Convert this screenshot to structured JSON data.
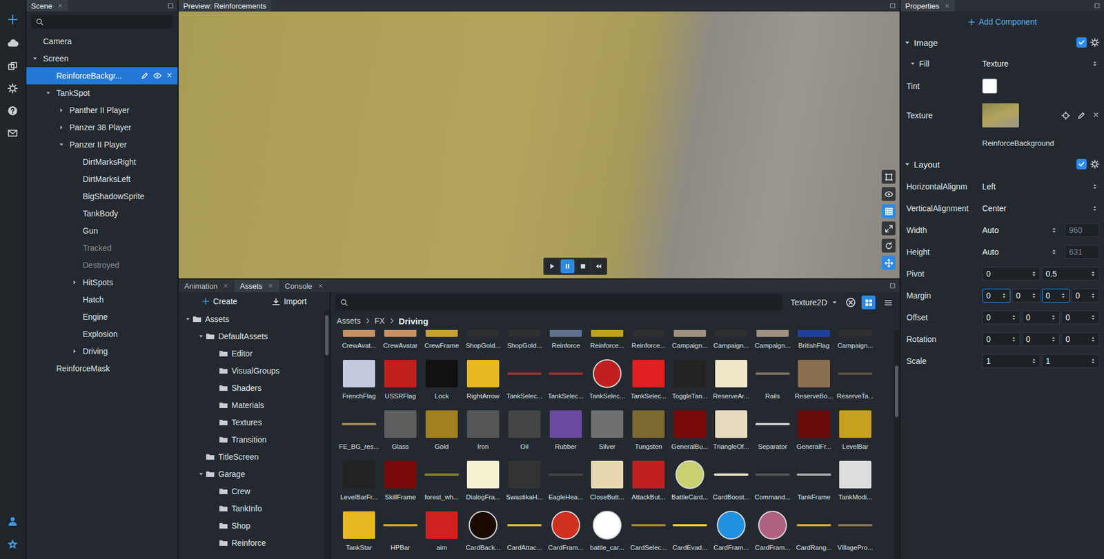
{
  "scene": {
    "tab": "Scene",
    "tree": [
      {
        "label": "Camera",
        "depth": 0,
        "has_children": false,
        "expanded": false,
        "selected": false,
        "disabled": false
      },
      {
        "label": "Screen",
        "depth": 0,
        "has_children": true,
        "expanded": true,
        "selected": false,
        "disabled": false
      },
      {
        "label": "ReinforceBackgr...",
        "depth": 1,
        "has_children": false,
        "expanded": false,
        "selected": true,
        "disabled": false
      },
      {
        "label": "TankSpot",
        "depth": 1,
        "has_children": true,
        "expanded": true,
        "selected": false,
        "disabled": false
      },
      {
        "label": "Panther II Player",
        "depth": 2,
        "has_children": true,
        "expanded": false,
        "selected": false,
        "disabled": false
      },
      {
        "label": "Panzer 38 Player",
        "depth": 2,
        "has_children": true,
        "expanded": false,
        "selected": false,
        "disabled": false
      },
      {
        "label": "Panzer II Player",
        "depth": 2,
        "has_children": true,
        "expanded": true,
        "selected": false,
        "disabled": false
      },
      {
        "label": "DirtMarksRight",
        "depth": 3,
        "has_children": false,
        "expanded": false,
        "selected": false,
        "disabled": false
      },
      {
        "label": "DirtMarksLeft",
        "depth": 3,
        "has_children": false,
        "expanded": false,
        "selected": false,
        "disabled": false
      },
      {
        "label": "BigShadowSprite",
        "depth": 3,
        "has_children": false,
        "expanded": false,
        "selected": false,
        "disabled": false
      },
      {
        "label": "TankBody",
        "depth": 3,
        "has_children": false,
        "expanded": false,
        "selected": false,
        "disabled": false
      },
      {
        "label": "Gun",
        "depth": 3,
        "has_children": false,
        "expanded": false,
        "selected": false,
        "disabled": false
      },
      {
        "label": "Tracked",
        "depth": 3,
        "has_children": false,
        "expanded": false,
        "selected": false,
        "disabled": true
      },
      {
        "label": "Destroyed",
        "depth": 3,
        "has_children": false,
        "expanded": false,
        "selected": false,
        "disabled": true
      },
      {
        "label": "HitSpots",
        "depth": 3,
        "has_children": true,
        "expanded": false,
        "selected": false,
        "disabled": false
      },
      {
        "label": "Hatch",
        "depth": 3,
        "has_children": false,
        "expanded": false,
        "selected": false,
        "disabled": false
      },
      {
        "label": "Engine",
        "depth": 3,
        "has_children": false,
        "expanded": false,
        "selected": false,
        "disabled": false
      },
      {
        "label": "Explosion",
        "depth": 3,
        "has_children": false,
        "expanded": false,
        "selected": false,
        "disabled": false
      },
      {
        "label": "Driving",
        "depth": 3,
        "has_children": true,
        "expanded": false,
        "selected": false,
        "disabled": false
      },
      {
        "label": "ReinforceMask",
        "depth": 1,
        "has_children": false,
        "expanded": false,
        "selected": false,
        "disabled": false
      }
    ]
  },
  "preview": {
    "tab": "Preview: Reinforcements",
    "tools": [
      {
        "kind": "select",
        "selected": false
      },
      {
        "kind": "visibility",
        "selected": false
      },
      {
        "kind": "grid",
        "selected": true
      },
      {
        "kind": "expand",
        "selected": false
      },
      {
        "kind": "refresh",
        "selected": false
      },
      {
        "kind": "move",
        "selected": true
      }
    ],
    "playback": [
      {
        "kind": "play",
        "selected": false
      },
      {
        "kind": "pause",
        "selected": true
      },
      {
        "kind": "stop",
        "selected": false
      },
      {
        "kind": "rewind",
        "selected": false
      }
    ]
  },
  "properties": {
    "tab": "Properties",
    "add_component": "Add Component",
    "image": {
      "title": "Image",
      "expanded": true,
      "enabled": true,
      "fill": {
        "label": "Fill",
        "value": "Texture",
        "expanded": true
      },
      "tint": {
        "label": "Tint",
        "color": "#ffffff"
      },
      "texture": {
        "label": "Texture",
        "name": "ReinforceBackground"
      }
    },
    "layout": {
      "title": "Layout",
      "expanded": true,
      "enabled": true,
      "rows": [
        {
          "kind": "dropdown",
          "label": "HorizontalAlignm",
          "value": "Left"
        },
        {
          "kind": "dropdown",
          "label": "VerticalAlignment",
          "value": "Center"
        },
        {
          "kind": "size",
          "label": "Width",
          "value": "Auto",
          "computed": "960",
          "disabled": true
        },
        {
          "kind": "size",
          "label": "Height",
          "value": "Auto",
          "computed": "631",
          "disabled": true
        },
        {
          "kind": "numbers",
          "label": "Pivot",
          "fields": [
            {
              "value": "0",
              "focused": false
            },
            {
              "value": "0.5",
              "focused": false
            }
          ]
        },
        {
          "kind": "numbers",
          "label": "Margin",
          "fields": [
            {
              "value": "0",
              "focused": true
            },
            {
              "value": "0",
              "focused": false
            },
            {
              "value": "0",
              "focused": true
            },
            {
              "value": "0",
              "focused": false
            }
          ]
        },
        {
          "kind": "numbers",
          "label": "Offset",
          "fields": [
            {
              "value": "0",
              "focused": false
            },
            {
              "value": "0",
              "focused": false
            },
            {
              "value": "0",
              "focused": false
            }
          ]
        },
        {
          "kind": "numbers",
          "label": "Rotation",
          "fields": [
            {
              "value": "0",
              "focused": false
            },
            {
              "value": "0",
              "focused": false
            },
            {
              "value": "0",
              "focused": false
            }
          ]
        },
        {
          "kind": "numbers",
          "label": "Scale",
          "fields": [
            {
              "value": "1",
              "focused": false
            },
            {
              "value": "1",
              "focused": false
            }
          ]
        }
      ]
    }
  },
  "bottom": {
    "tabs": [
      {
        "label": "Animation",
        "selected": false
      },
      {
        "label": "Assets",
        "selected": true
      },
      {
        "label": "Console",
        "selected": false
      }
    ],
    "assets": {
      "create": "Create",
      "import": "Import",
      "tree": [
        {
          "label": "Assets",
          "depth": 0,
          "has_children": true,
          "expanded": true
        },
        {
          "label": "DefaultAssets",
          "depth": 1,
          "has_children": true,
          "expanded": true
        },
        {
          "label": "Editor",
          "depth": 2,
          "has_children": false,
          "expanded": false
        },
        {
          "label": "VisualGroups",
          "depth": 2,
          "has_children": false,
          "expanded": false
        },
        {
          "label": "Shaders",
          "depth": 2,
          "has_children": false,
          "expanded": false
        },
        {
          "label": "Materials",
          "depth": 2,
          "has_children": false,
          "expanded": false
        },
        {
          "label": "Textures",
          "depth": 2,
          "has_children": false,
          "expanded": false
        },
        {
          "label": "Transition",
          "depth": 2,
          "has_children": false,
          "expanded": false
        },
        {
          "label": "TitleScreen",
          "depth": 1,
          "has_children": false,
          "expanded": false
        },
        {
          "label": "Garage",
          "depth": 1,
          "has_children": true,
          "expanded": true
        },
        {
          "label": "Crew",
          "depth": 2,
          "has_children": false,
          "expanded": false
        },
        {
          "label": "TankInfo",
          "depth": 2,
          "has_children": false,
          "expanded": false
        },
        {
          "label": "Shop",
          "depth": 2,
          "has_children": false,
          "expanded": false
        },
        {
          "label": "Reinforce",
          "depth": 2,
          "has_children": false,
          "expanded": false
        }
      ],
      "filter": "Texture2D",
      "views": [
        {
          "kind": "grid",
          "selected": true
        },
        {
          "kind": "list",
          "selected": false
        }
      ],
      "breadcrumb": [
        "Assets",
        "FX",
        "Driving"
      ],
      "items": [
        {
          "name": "CrewAvat...",
          "kind": "rect",
          "color": "#c89060"
        },
        {
          "name": "CrewAvatar",
          "kind": "rect",
          "color": "#c89060"
        },
        {
          "name": "CrewFrame",
          "kind": "rect",
          "color": "#c8a030"
        },
        {
          "name": "ShopGold...",
          "kind": "rect",
          "color": "#303030"
        },
        {
          "name": "ShopGold...",
          "kind": "rect",
          "color": "#303030"
        },
        {
          "name": "Reinforce",
          "kind": "rect",
          "color": "#607090"
        },
        {
          "name": "Reinforce...",
          "kind": "rect",
          "color": "#c0a020"
        },
        {
          "name": "Reinforce...",
          "kind": "rect",
          "color": "#303030"
        },
        {
          "name": "Campaign...",
          "kind": "rect",
          "color": "#a09080"
        },
        {
          "name": "Campaign...",
          "kind": "rect",
          "color": "#303030"
        },
        {
          "name": "Campaign...",
          "kind": "rect",
          "color": "#a09080"
        },
        {
          "name": "BritishFlag",
          "kind": "rect",
          "color": "#2040a0"
        },
        {
          "name": "Campaign...",
          "kind": "rect",
          "color": "#303030"
        },
        {
          "name": "FrenchFlag",
          "kind": "rect",
          "color": "#c4cbe0"
        },
        {
          "name": "USSRFlag",
          "kind": "rect",
          "color": "#c0201c"
        },
        {
          "name": "Lock",
          "kind": "rect",
          "color": "#111111"
        },
        {
          "name": "RightArrow",
          "kind": "rect",
          "color": "#e8b820"
        },
        {
          "name": "TankSelec...",
          "kind": "line",
          "color": "#a03030"
        },
        {
          "name": "TankSelec...",
          "kind": "line",
          "color": "#a03030"
        },
        {
          "name": "TankSelec...",
          "kind": "circle",
          "color": "#c02020"
        },
        {
          "name": "TankSelec...",
          "kind": "rect",
          "color": "#e02020"
        },
        {
          "name": "ToggleTan...",
          "kind": "rect",
          "color": "#222222"
        },
        {
          "name": "ReserveAr...",
          "kind": "rect",
          "color": "#f0e8c8"
        },
        {
          "name": "Rails",
          "kind": "line",
          "color": "#807060"
        },
        {
          "name": "ReserveBo...",
          "kind": "rect",
          "color": "#8a7050"
        },
        {
          "name": "ReserveTa...",
          "kind": "line",
          "color": "#605040"
        },
        {
          "name": "FE_BG_res...",
          "kind": "line",
          "color": "#a08860"
        },
        {
          "name": "Glass",
          "kind": "rect",
          "color": "#5e5e5e"
        },
        {
          "name": "Gold",
          "kind": "rect",
          "color": "#a08020"
        },
        {
          "name": "Iron",
          "kind": "rect",
          "color": "#555555"
        },
        {
          "name": "Oil",
          "kind": "rect",
          "color": "#444444"
        },
        {
          "name": "Rubber",
          "kind": "rect",
          "color": "#6a4aa0"
        },
        {
          "name": "Silver",
          "kind": "rect",
          "color": "#707070"
        },
        {
          "name": "Tungsten",
          "kind": "rect",
          "color": "#7a6a30"
        },
        {
          "name": "GeneralBu...",
          "kind": "rect",
          "color": "#7a0a0a"
        },
        {
          "name": "TriangleOf...",
          "kind": "rect",
          "color": "#e8dcc0"
        },
        {
          "name": "Separator",
          "kind": "line",
          "color": "#cccccc"
        },
        {
          "name": "GeneralFr...",
          "kind": "rect",
          "color": "#6a0a0a"
        },
        {
          "name": "LevelBar",
          "kind": "rect",
          "color": "#c8a020"
        },
        {
          "name": "LevelBarFr...",
          "kind": "rect",
          "color": "#222222"
        },
        {
          "name": "SkillFrame",
          "kind": "rect",
          "color": "#7a0a0a"
        },
        {
          "name": "forest_wh...",
          "kind": "line",
          "color": "#8a8030"
        },
        {
          "name": "DialogFra...",
          "kind": "rect",
          "color": "#f5f0d0"
        },
        {
          "name": "SwastikaH...",
          "kind": "rect",
          "color": "#333333"
        },
        {
          "name": "EagleHea...",
          "kind": "line",
          "color": "#444444"
        },
        {
          "name": "CloseButt...",
          "kind": "rect",
          "color": "#e8d8b0"
        },
        {
          "name": "AttackBut...",
          "kind": "rect",
          "color": "#c02020"
        },
        {
          "name": "BattleCard...",
          "kind": "circle",
          "color": "#c8d070"
        },
        {
          "name": "CardBoost...",
          "kind": "line",
          "color": "#f0e8c8"
        },
        {
          "name": "Command...",
          "kind": "line",
          "color": "#555555"
        },
        {
          "name": "TankFrame",
          "kind": "line",
          "color": "#aaaaaa"
        },
        {
          "name": "TankModi...",
          "kind": "rect",
          "color": "#dddddd"
        },
        {
          "name": "TankStar",
          "kind": "rect",
          "color": "#e8b820"
        },
        {
          "name": "HPBar",
          "kind": "line",
          "color": "#c8a020"
        },
        {
          "name": "aim",
          "kind": "rect",
          "color": "#d02020"
        },
        {
          "name": "CardBack...",
          "kind": "circle",
          "color": "#1a0a00"
        },
        {
          "name": "CardAttac...",
          "kind": "line",
          "color": "#d0b040"
        },
        {
          "name": "CardFram...",
          "kind": "circle",
          "color": "#d03020"
        },
        {
          "name": "battle_car...",
          "kind": "circle",
          "color": "#ffffff"
        },
        {
          "name": "CardSelec...",
          "kind": "line",
          "color": "#a08030"
        },
        {
          "name": "CardEvad...",
          "kind": "line",
          "color": "#e8c030"
        },
        {
          "name": "CardFram...",
          "kind": "circle",
          "color": "#2090e0"
        },
        {
          "name": "CardFram...",
          "kind": "circle",
          "color": "#b06080"
        },
        {
          "name": "CardRang...",
          "kind": "line",
          "color": "#d0a030"
        },
        {
          "name": "VillagePro...",
          "kind": "line",
          "color": "#8a7050"
        }
      ]
    }
  }
}
